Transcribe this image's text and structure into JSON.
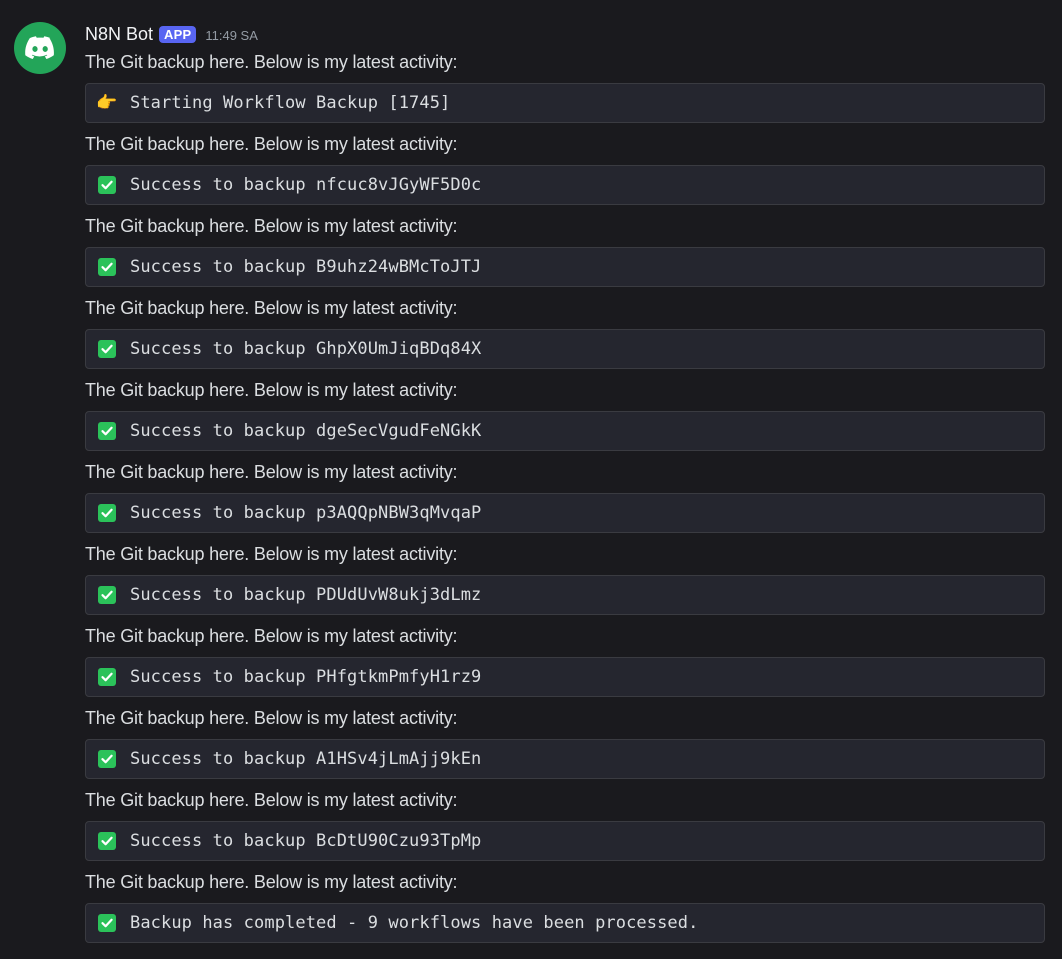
{
  "message": {
    "author": "N8N Bot",
    "badge": "APP",
    "timestamp": "11:49 SA"
  },
  "entries": [
    {
      "text": "The Git backup here. Below is my latest activity:",
      "icon": "backhand-index-pointing-right-icon",
      "code": "Starting Workflow Backup [1745]"
    },
    {
      "text": "The Git backup here. Below is my latest activity:",
      "icon": "check-mark-button-icon",
      "code": "Success to backup nfcuc8vJGyWF5D0c"
    },
    {
      "text": "The Git backup here. Below is my latest activity:",
      "icon": "check-mark-button-icon",
      "code": "Success to backup B9uhz24wBMcToJTJ"
    },
    {
      "text": "The Git backup here. Below is my latest activity:",
      "icon": "check-mark-button-icon",
      "code": "Success to backup GhpX0UmJiqBDq84X"
    },
    {
      "text": "The Git backup here. Below is my latest activity:",
      "icon": "check-mark-button-icon",
      "code": "Success to backup dgeSecVgudFeNGkK"
    },
    {
      "text": "The Git backup here. Below is my latest activity:",
      "icon": "check-mark-button-icon",
      "code": "Success to backup p3AQQpNBW3qMvqaP"
    },
    {
      "text": "The Git backup here. Below is my latest activity:",
      "icon": "check-mark-button-icon",
      "code": "Success to backup PDUdUvW8ukj3dLmz"
    },
    {
      "text": "The Git backup here. Below is my latest activity:",
      "icon": "check-mark-button-icon",
      "code": "Success to backup PHfgtkmPmfyH1rz9"
    },
    {
      "text": "The Git backup here. Below is my latest activity:",
      "icon": "check-mark-button-icon",
      "code": "Success to backup A1HSv4jLmAjj9kEn"
    },
    {
      "text": "The Git backup here. Below is my latest activity:",
      "icon": "check-mark-button-icon",
      "code": "Success to backup BcDtU90Czu93TpMp"
    },
    {
      "text": "The Git backup here. Below is my latest activity:",
      "icon": "check-mark-button-icon",
      "code": "Backup has completed - 9 workflows have been processed."
    }
  ],
  "colors": {
    "background": "#1a1a1e",
    "code_background": "#25262f",
    "badge": "#5865f2",
    "avatar": "#23a559",
    "check": "#2bc25a"
  }
}
